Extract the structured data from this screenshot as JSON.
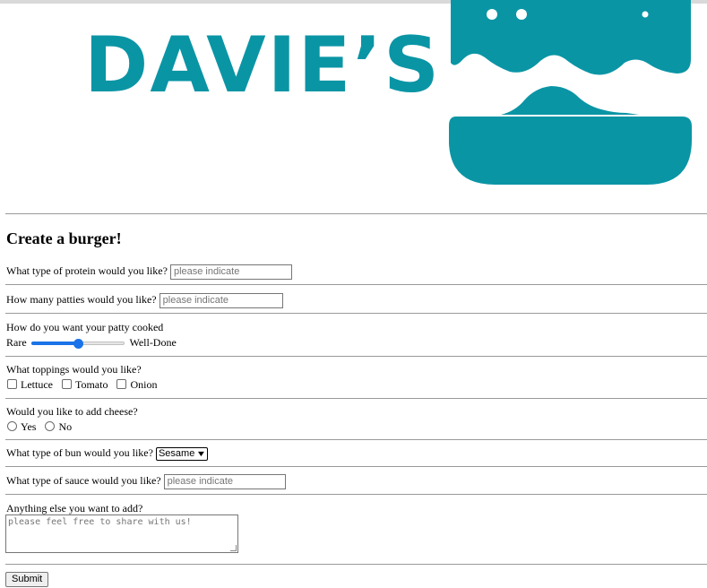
{
  "header": {
    "logo_text": "DAVIE’S",
    "brand_color": "#0a95a5"
  },
  "form": {
    "title": "Create a burger!",
    "protein": {
      "label": "What type of protein would you like?",
      "placeholder": "please indicate"
    },
    "patties": {
      "label": "How many patties would you like?",
      "placeholder": "please indicate"
    },
    "cooked": {
      "label": "How do you want your patty cooked",
      "min_label": "Rare",
      "max_label": "Well-Done",
      "value_fraction": 0.5
    },
    "toppings": {
      "label": "What toppings would you like?",
      "options": [
        "Lettuce",
        "Tomato",
        "Onion"
      ]
    },
    "cheese": {
      "label": "Would you like to add cheese?",
      "options": [
        "Yes",
        "No"
      ]
    },
    "bun": {
      "label": "What type of bun would you like?",
      "selected": "Sesame"
    },
    "sauce": {
      "label": "What type of sauce would you like?",
      "placeholder": "please indicate"
    },
    "notes": {
      "label": "Anything else you want to add?",
      "placeholder": "please feel free to share with us!"
    },
    "submit_label": "Submit"
  }
}
